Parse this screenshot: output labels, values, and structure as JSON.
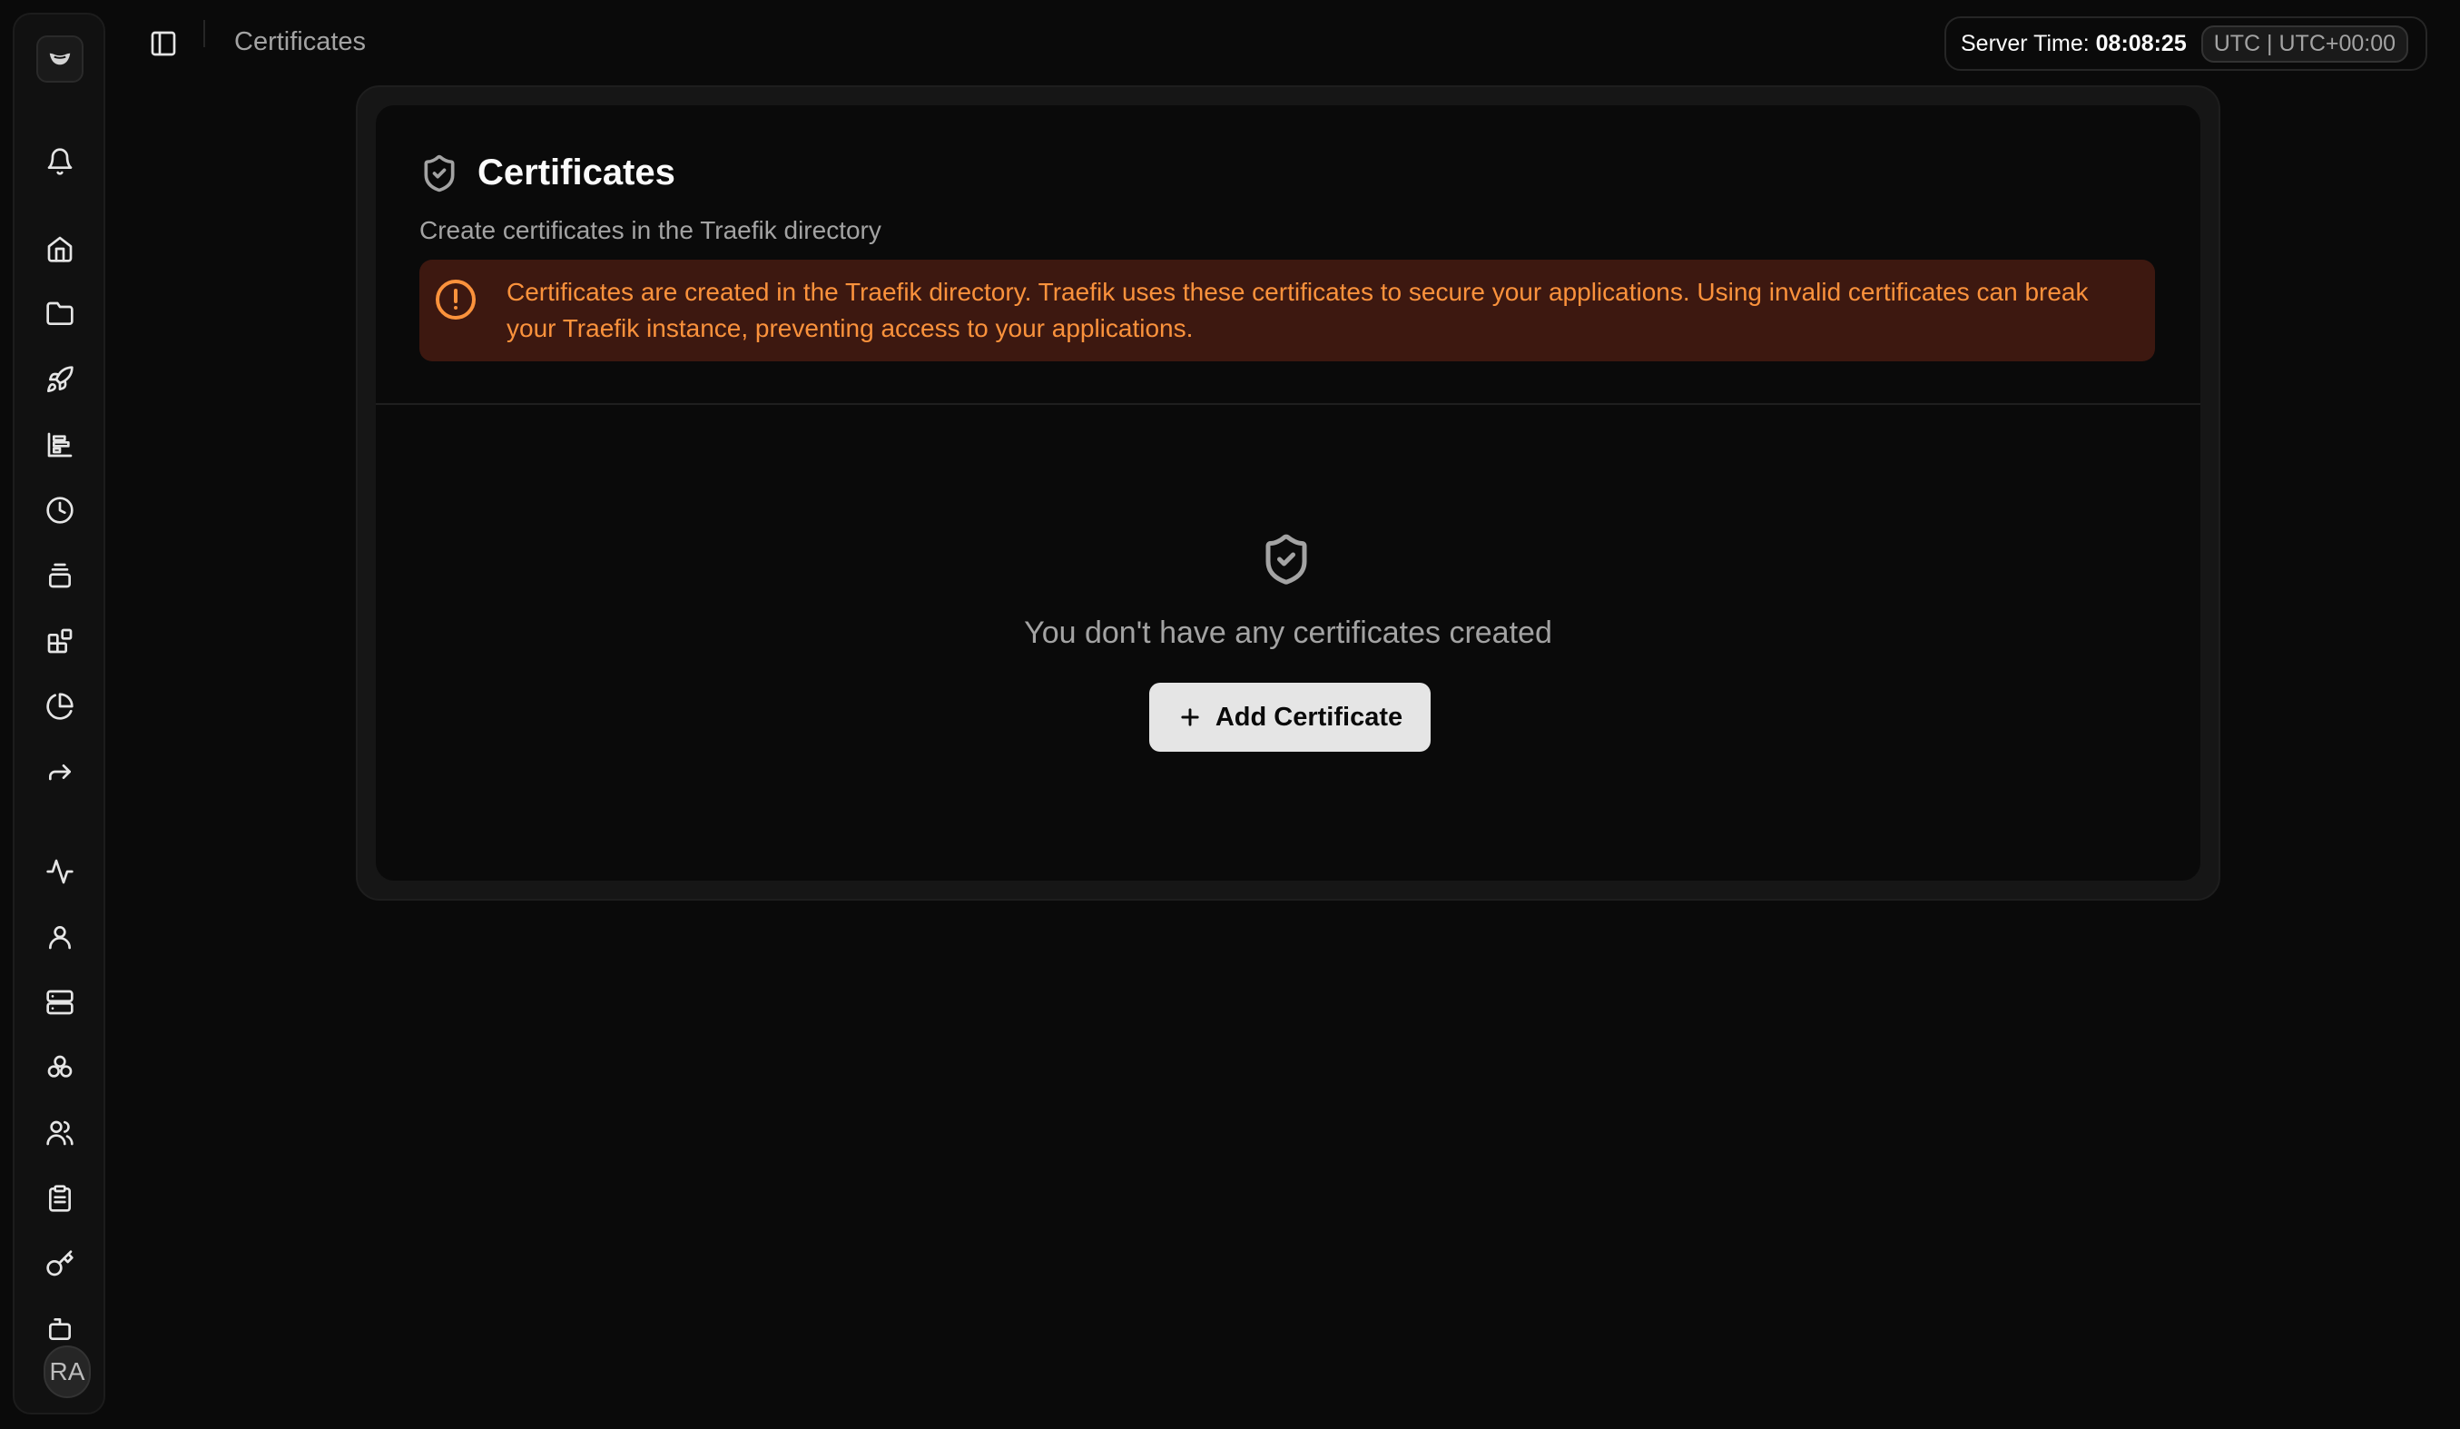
{
  "header": {
    "breadcrumb": "Certificates",
    "server_time_label": "Server Time:",
    "server_time_value": "08:08:25",
    "timezone": "UTC | UTC+00:00"
  },
  "sidebar": {
    "icons": [
      "bell-icon",
      "home-icon",
      "folder-icon",
      "rocket-icon",
      "chart-icon",
      "clock-icon",
      "layers-icon",
      "blocks-icon",
      "pie-chart-icon",
      "forward-icon",
      "activity-icon",
      "user-icon",
      "server-icon",
      "cluster-icon",
      "users-icon",
      "clipboard-icon",
      "key-icon",
      "bot-icon"
    ],
    "avatar_initials": "RA"
  },
  "card": {
    "title": "Certificates",
    "subtitle": "Create certificates in the Traefik directory",
    "alert_text": "Certificates are created in the Traefik directory. Traefik uses these certificates to secure your applications. Using invalid certificates can break your Traefik instance, preventing access to your applications.",
    "empty_text": "You don't have any certificates created",
    "add_button": "Add Certificate"
  },
  "colors": {
    "background": "#0a0a0a",
    "alert_bg": "#3d1810",
    "alert_text": "#fb923c",
    "button_bg": "#e5e5e5"
  }
}
